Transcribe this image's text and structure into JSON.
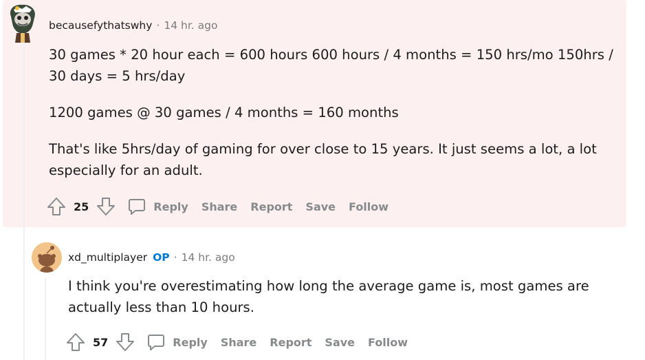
{
  "comments": [
    {
      "author": "becausefythatswhy",
      "separator": "·",
      "time": "14 hr. ago",
      "paragraphs": [
        "30 games * 20 hour each = 600 hours 600 hours / 4 months = 150 hrs/mo 150hrs / 30 days = 5 hrs/day",
        "1200 games @ 30 games / 4 months = 160 months",
        "That's like 5hrs/day of gaming for over close to 15 years. It just seems a lot, a lot especially for an adult."
      ],
      "score": "25",
      "actions": {
        "reply": "Reply",
        "share": "Share",
        "report": "Report",
        "save": "Save",
        "follow": "Follow"
      },
      "highlight_color": "#fdf0f1"
    },
    {
      "author": "xd_multiplayer",
      "badge": "OP",
      "separator": "·",
      "time": "14 hr. ago",
      "paragraphs": [
        "I think you're overestimating how long the average game is, most games are actually less than 10 hours."
      ],
      "score": "57",
      "actions": {
        "reply": "Reply",
        "share": "Share",
        "report": "Report",
        "save": "Save",
        "follow": "Follow"
      }
    }
  ],
  "icons": {
    "upvote": "upvote-icon",
    "downvote": "downvote-icon",
    "reply": "comment-bubble-icon",
    "avatar1": "mascot-avatar-icon",
    "avatar2": "default-snoo-avatar-icon"
  },
  "colors": {
    "op_badge": "#0079d3",
    "action_text": "#878a8c",
    "meta_text": "#7c7c7c"
  }
}
